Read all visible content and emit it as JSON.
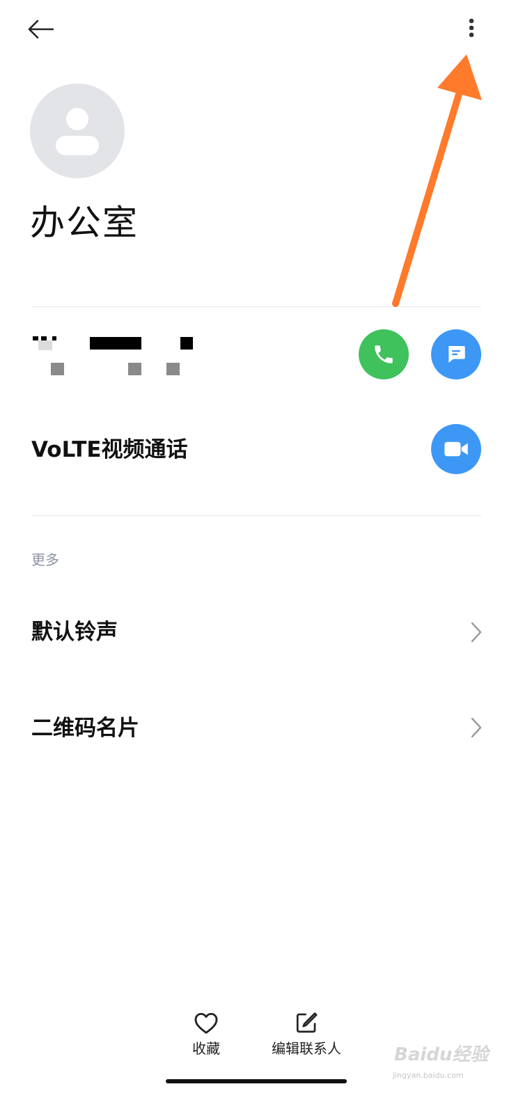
{
  "contact": {
    "name": "办公室"
  },
  "phone_row": {
    "call_button_color": "#3fc15c",
    "message_button_color": "#3d97f5"
  },
  "volte_row": {
    "label": "VoLTE视频通话",
    "video_button_color": "#3d97f5"
  },
  "more_section": {
    "title": "更多",
    "items": [
      {
        "label": "默认铃声"
      },
      {
        "label": "二维码名片"
      }
    ]
  },
  "bottom_bar": {
    "favorite_label": "收藏",
    "edit_label": "编辑联系人"
  },
  "annotation": {
    "arrow_color": "#ff7a2b"
  },
  "watermark": {
    "brand": "Baidu经验",
    "url": "jingyan.baidu.com"
  },
  "icons": [
    "back-arrow-icon",
    "more-vert-icon",
    "person-icon",
    "phone-icon",
    "message-icon",
    "video-icon",
    "chevron-right-icon",
    "heart-icon",
    "edit-icon"
  ]
}
